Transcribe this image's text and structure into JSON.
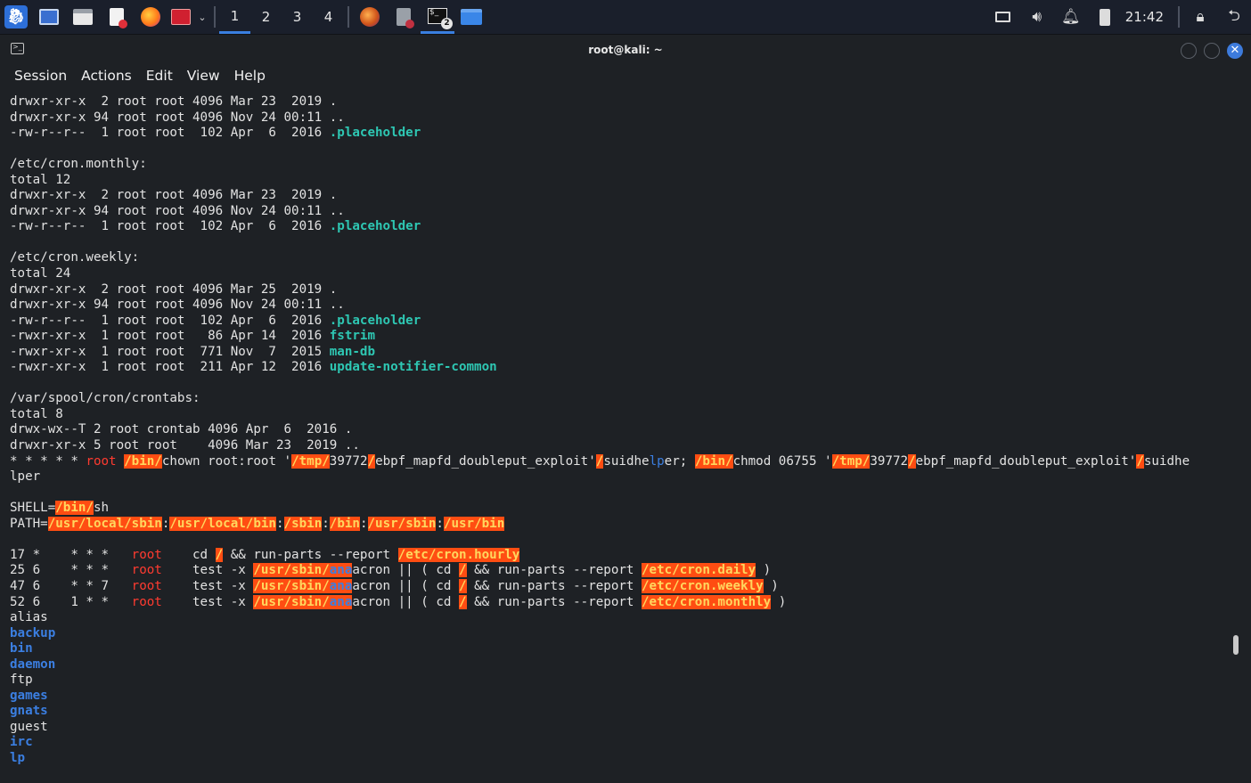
{
  "panel": {
    "workspaces": [
      "1",
      "2",
      "3",
      "4"
    ],
    "active_workspace": "1",
    "clock": "21:42",
    "terminal_badge": "2"
  },
  "window": {
    "title": "root@kali: ~",
    "menu": [
      "Session",
      "Actions",
      "Edit",
      "View",
      "Help"
    ]
  },
  "terminal": {
    "lines": [
      [
        [
          "drwxr-xr-x  2 root root 4096 Mar 23  2019 .",
          ""
        ]
      ],
      [
        [
          "drwxr-xr-x 94 root root 4096 Nov 24 00:11 ..",
          ""
        ]
      ],
      [
        [
          "-rw-r--r--  1 root root  102 Apr  6  2016 ",
          ""
        ],
        [
          ".placeholder",
          "g"
        ]
      ],
      [
        [
          "",
          ""
        ]
      ],
      [
        [
          "/etc/cron.monthly:",
          ""
        ]
      ],
      [
        [
          "total 12",
          ""
        ]
      ],
      [
        [
          "drwxr-xr-x  2 root root 4096 Mar 23  2019 .",
          ""
        ]
      ],
      [
        [
          "drwxr-xr-x 94 root root 4096 Nov 24 00:11 ..",
          ""
        ]
      ],
      [
        [
          "-rw-r--r--  1 root root  102 Apr  6  2016 ",
          ""
        ],
        [
          ".placeholder",
          "g"
        ]
      ],
      [
        [
          "",
          ""
        ]
      ],
      [
        [
          "/etc/cron.weekly:",
          ""
        ]
      ],
      [
        [
          "total 24",
          ""
        ]
      ],
      [
        [
          "drwxr-xr-x  2 root root 4096 Mar 25  2019 .",
          ""
        ]
      ],
      [
        [
          "drwxr-xr-x 94 root root 4096 Nov 24 00:11 ..",
          ""
        ]
      ],
      [
        [
          "-rw-r--r--  1 root root  102 Apr  6  2016 ",
          ""
        ],
        [
          ".placeholder",
          "g"
        ]
      ],
      [
        [
          "-rwxr-xr-x  1 root root   86 Apr 14  2016 ",
          ""
        ],
        [
          "fstrim",
          "g"
        ]
      ],
      [
        [
          "-rwxr-xr-x  1 root root  771 Nov  7  2015 ",
          ""
        ],
        [
          "man-db",
          "g"
        ]
      ],
      [
        [
          "-rwxr-xr-x  1 root root  211 Apr 12  2016 ",
          ""
        ],
        [
          "update-notifier-common",
          "g"
        ]
      ],
      [
        [
          "",
          ""
        ]
      ],
      [
        [
          "/var/spool/cron/crontabs:",
          ""
        ]
      ],
      [
        [
          "total 8",
          ""
        ]
      ],
      [
        [
          "drwx-wx--T 2 root crontab 4096 Apr  6  2016 .",
          ""
        ]
      ],
      [
        [
          "drwxr-xr-x 5 root root    4096 Mar 23  2019 ..",
          ""
        ]
      ],
      [
        [
          "* * * * * ",
          ""
        ],
        [
          "root",
          "rd"
        ],
        [
          " ",
          ""
        ],
        [
          "/bin/",
          "hl"
        ],
        [
          "chown root:root '",
          ""
        ],
        [
          "/tmp/",
          "hl"
        ],
        [
          "39772",
          ""
        ],
        [
          "/",
          "hl"
        ],
        [
          "ebpf_mapfd_doubleput_exploit'",
          ""
        ],
        [
          "/",
          "hl"
        ],
        [
          "suidhe",
          ""
        ],
        [
          "lp",
          "bl"
        ],
        [
          "er; ",
          ""
        ],
        [
          "/bin/",
          "hl"
        ],
        [
          "chmod 06755 '",
          ""
        ],
        [
          "/tmp/",
          "hl"
        ],
        [
          "39772",
          ""
        ],
        [
          "/",
          "hl"
        ],
        [
          "ebpf_mapfd_doubleput_exploit'",
          ""
        ],
        [
          "/",
          "hl"
        ],
        [
          "suidhe",
          ""
        ]
      ],
      [
        [
          "lper",
          ""
        ]
      ],
      [
        [
          "",
          ""
        ]
      ],
      [
        [
          "SHELL=",
          ""
        ],
        [
          "/bin/",
          "hl"
        ],
        [
          "sh",
          ""
        ]
      ],
      [
        [
          "PATH=",
          ""
        ],
        [
          "/usr/local/sbin",
          "hl"
        ],
        [
          ":",
          ""
        ],
        [
          "/usr/local/bin",
          "hl"
        ],
        [
          ":",
          ""
        ],
        [
          "/sbin",
          "hl"
        ],
        [
          ":",
          ""
        ],
        [
          "/bin",
          "hl"
        ],
        [
          ":",
          ""
        ],
        [
          "/usr/sbin",
          "hl"
        ],
        [
          ":",
          ""
        ],
        [
          "/usr/bin",
          "hl"
        ]
      ],
      [
        [
          "",
          ""
        ]
      ],
      [
        [
          "17 *    * * *   ",
          ""
        ],
        [
          "root",
          "rd"
        ],
        [
          "    cd ",
          ""
        ],
        [
          "/",
          "hl"
        ],
        [
          " && run-parts --report ",
          ""
        ],
        [
          "/etc/cron.hourly",
          "hl"
        ]
      ],
      [
        [
          "25 6    * * *   ",
          ""
        ],
        [
          "root",
          "rd"
        ],
        [
          "    test -x ",
          ""
        ],
        [
          "/usr/sbin/",
          "hl"
        ],
        [
          "ana",
          "hlb"
        ],
        [
          "acron || ( cd ",
          ""
        ],
        [
          "/",
          "hl"
        ],
        [
          " && run-parts --report ",
          ""
        ],
        [
          "/etc/cron.daily",
          "hl"
        ],
        [
          " )",
          ""
        ]
      ],
      [
        [
          "47 6    * * 7   ",
          ""
        ],
        [
          "root",
          "rd"
        ],
        [
          "    test -x ",
          ""
        ],
        [
          "/usr/sbin/",
          "hl"
        ],
        [
          "ana",
          "hlb"
        ],
        [
          "acron || ( cd ",
          ""
        ],
        [
          "/",
          "hl"
        ],
        [
          " && run-parts --report ",
          ""
        ],
        [
          "/etc/cron.weekly",
          "hl"
        ],
        [
          " )",
          ""
        ]
      ],
      [
        [
          "52 6    1 * *   ",
          ""
        ],
        [
          "root",
          "rd"
        ],
        [
          "    test -x ",
          ""
        ],
        [
          "/usr/sbin/",
          "hl"
        ],
        [
          "ana",
          "hlb"
        ],
        [
          "acron || ( cd ",
          ""
        ],
        [
          "/",
          "hl"
        ],
        [
          " && run-parts --report ",
          ""
        ],
        [
          "/etc/cron.monthly",
          "hl"
        ],
        [
          " )",
          ""
        ]
      ],
      [
        [
          "alias",
          ""
        ]
      ],
      [
        [
          "backup",
          "b"
        ]
      ],
      [
        [
          "bin",
          "b"
        ]
      ],
      [
        [
          "daemon",
          "b"
        ]
      ],
      [
        [
          "ftp",
          ""
        ]
      ],
      [
        [
          "games",
          "b"
        ]
      ],
      [
        [
          "gnats",
          "b"
        ]
      ],
      [
        [
          "guest",
          ""
        ]
      ],
      [
        [
          "irc",
          "b"
        ]
      ],
      [
        [
          "lp",
          "b"
        ]
      ]
    ]
  }
}
